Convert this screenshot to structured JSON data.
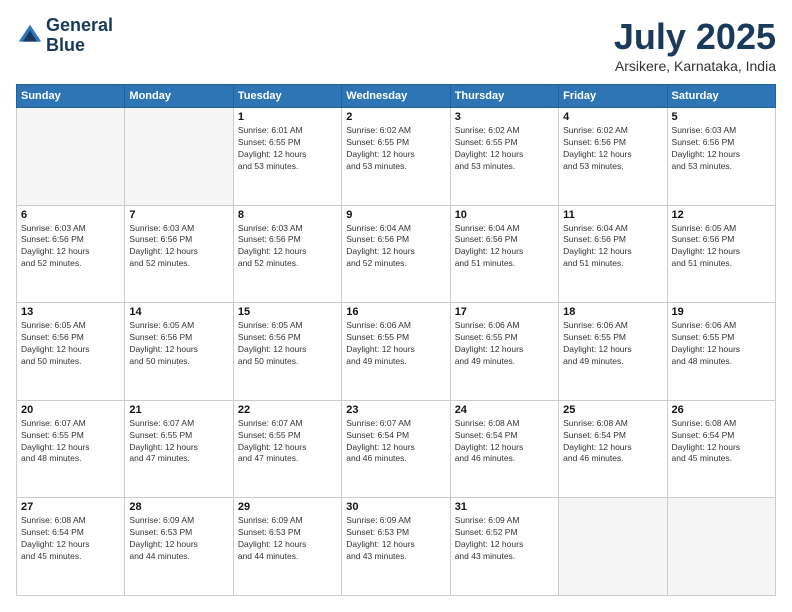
{
  "header": {
    "logo_line1": "General",
    "logo_line2": "Blue",
    "month_title": "July 2025",
    "location": "Arsikere, Karnataka, India"
  },
  "days_of_week": [
    "Sunday",
    "Monday",
    "Tuesday",
    "Wednesday",
    "Thursday",
    "Friday",
    "Saturday"
  ],
  "weeks": [
    [
      {
        "day": "",
        "info": ""
      },
      {
        "day": "",
        "info": ""
      },
      {
        "day": "1",
        "info": "Sunrise: 6:01 AM\nSunset: 6:55 PM\nDaylight: 12 hours\nand 53 minutes."
      },
      {
        "day": "2",
        "info": "Sunrise: 6:02 AM\nSunset: 6:55 PM\nDaylight: 12 hours\nand 53 minutes."
      },
      {
        "day": "3",
        "info": "Sunrise: 6:02 AM\nSunset: 6:55 PM\nDaylight: 12 hours\nand 53 minutes."
      },
      {
        "day": "4",
        "info": "Sunrise: 6:02 AM\nSunset: 6:56 PM\nDaylight: 12 hours\nand 53 minutes."
      },
      {
        "day": "5",
        "info": "Sunrise: 6:03 AM\nSunset: 6:56 PM\nDaylight: 12 hours\nand 53 minutes."
      }
    ],
    [
      {
        "day": "6",
        "info": "Sunrise: 6:03 AM\nSunset: 6:56 PM\nDaylight: 12 hours\nand 52 minutes."
      },
      {
        "day": "7",
        "info": "Sunrise: 6:03 AM\nSunset: 6:56 PM\nDaylight: 12 hours\nand 52 minutes."
      },
      {
        "day": "8",
        "info": "Sunrise: 6:03 AM\nSunset: 6:56 PM\nDaylight: 12 hours\nand 52 minutes."
      },
      {
        "day": "9",
        "info": "Sunrise: 6:04 AM\nSunset: 6:56 PM\nDaylight: 12 hours\nand 52 minutes."
      },
      {
        "day": "10",
        "info": "Sunrise: 6:04 AM\nSunset: 6:56 PM\nDaylight: 12 hours\nand 51 minutes."
      },
      {
        "day": "11",
        "info": "Sunrise: 6:04 AM\nSunset: 6:56 PM\nDaylight: 12 hours\nand 51 minutes."
      },
      {
        "day": "12",
        "info": "Sunrise: 6:05 AM\nSunset: 6:56 PM\nDaylight: 12 hours\nand 51 minutes."
      }
    ],
    [
      {
        "day": "13",
        "info": "Sunrise: 6:05 AM\nSunset: 6:56 PM\nDaylight: 12 hours\nand 50 minutes."
      },
      {
        "day": "14",
        "info": "Sunrise: 6:05 AM\nSunset: 6:56 PM\nDaylight: 12 hours\nand 50 minutes."
      },
      {
        "day": "15",
        "info": "Sunrise: 6:05 AM\nSunset: 6:56 PM\nDaylight: 12 hours\nand 50 minutes."
      },
      {
        "day": "16",
        "info": "Sunrise: 6:06 AM\nSunset: 6:55 PM\nDaylight: 12 hours\nand 49 minutes."
      },
      {
        "day": "17",
        "info": "Sunrise: 6:06 AM\nSunset: 6:55 PM\nDaylight: 12 hours\nand 49 minutes."
      },
      {
        "day": "18",
        "info": "Sunrise: 6:06 AM\nSunset: 6:55 PM\nDaylight: 12 hours\nand 49 minutes."
      },
      {
        "day": "19",
        "info": "Sunrise: 6:06 AM\nSunset: 6:55 PM\nDaylight: 12 hours\nand 48 minutes."
      }
    ],
    [
      {
        "day": "20",
        "info": "Sunrise: 6:07 AM\nSunset: 6:55 PM\nDaylight: 12 hours\nand 48 minutes."
      },
      {
        "day": "21",
        "info": "Sunrise: 6:07 AM\nSunset: 6:55 PM\nDaylight: 12 hours\nand 47 minutes."
      },
      {
        "day": "22",
        "info": "Sunrise: 6:07 AM\nSunset: 6:55 PM\nDaylight: 12 hours\nand 47 minutes."
      },
      {
        "day": "23",
        "info": "Sunrise: 6:07 AM\nSunset: 6:54 PM\nDaylight: 12 hours\nand 46 minutes."
      },
      {
        "day": "24",
        "info": "Sunrise: 6:08 AM\nSunset: 6:54 PM\nDaylight: 12 hours\nand 46 minutes."
      },
      {
        "day": "25",
        "info": "Sunrise: 6:08 AM\nSunset: 6:54 PM\nDaylight: 12 hours\nand 46 minutes."
      },
      {
        "day": "26",
        "info": "Sunrise: 6:08 AM\nSunset: 6:54 PM\nDaylight: 12 hours\nand 45 minutes."
      }
    ],
    [
      {
        "day": "27",
        "info": "Sunrise: 6:08 AM\nSunset: 6:54 PM\nDaylight: 12 hours\nand 45 minutes."
      },
      {
        "day": "28",
        "info": "Sunrise: 6:09 AM\nSunset: 6:53 PM\nDaylight: 12 hours\nand 44 minutes."
      },
      {
        "day": "29",
        "info": "Sunrise: 6:09 AM\nSunset: 6:53 PM\nDaylight: 12 hours\nand 44 minutes."
      },
      {
        "day": "30",
        "info": "Sunrise: 6:09 AM\nSunset: 6:53 PM\nDaylight: 12 hours\nand 43 minutes."
      },
      {
        "day": "31",
        "info": "Sunrise: 6:09 AM\nSunset: 6:52 PM\nDaylight: 12 hours\nand 43 minutes."
      },
      {
        "day": "",
        "info": ""
      },
      {
        "day": "",
        "info": ""
      }
    ]
  ]
}
